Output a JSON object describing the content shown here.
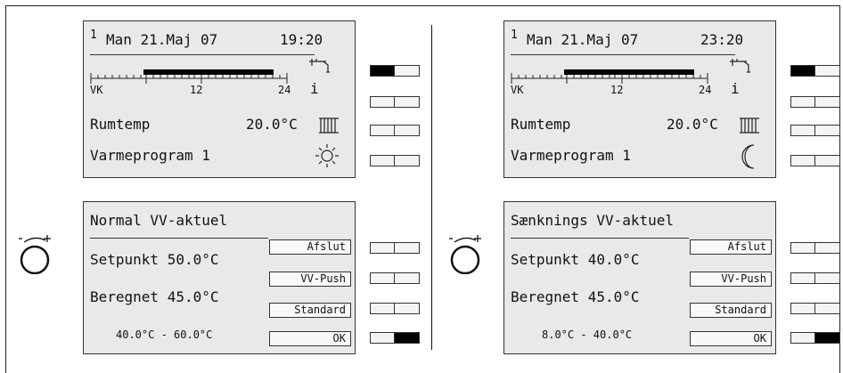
{
  "panels": [
    {
      "screen1": {
        "line_number": "1",
        "day_date": "Man 21.Maj 07",
        "time": "19:20",
        "timeline_left": "VK",
        "timeline_mid": "12",
        "timeline_right": "24",
        "info_glyph": "i",
        "room_label": "Rumtemp",
        "room_value": "20.0°C",
        "program_label": "Varmeprogram 1",
        "mode_icon": "sun-icon"
      },
      "screen2": {
        "title": "Normal VV-aktuel",
        "setpoint": "Setpunkt 50.0°C",
        "calculated": "Beregnet 45.0°C",
        "range": "40.0°C - 60.0°C",
        "softkeys": [
          "Afslut",
          "VV-Push",
          "Standard",
          "OK"
        ]
      }
    },
    {
      "screen1": {
        "line_number": "1",
        "day_date": "Man 21.Maj 07",
        "time": "23:20",
        "timeline_left": "VK",
        "timeline_mid": "12",
        "timeline_right": "24",
        "info_glyph": "i",
        "room_label": "Rumtemp",
        "room_value": "20.0°C",
        "program_label": "Varmeprogram 1",
        "mode_icon": "moon-icon"
      },
      "screen2": {
        "title": "Sænknings VV-aktuel",
        "setpoint": "Setpunkt 40.0°C",
        "calculated": "Beregnet 45.0°C",
        "range": "8.0°C - 40.0°C",
        "softkeys": [
          "Afslut",
          "VV-Push",
          "Standard",
          "OK"
        ]
      }
    }
  ],
  "colors": {
    "screen_bg": "#e9e9e9",
    "line": "#333333",
    "bar": "#000000"
  }
}
